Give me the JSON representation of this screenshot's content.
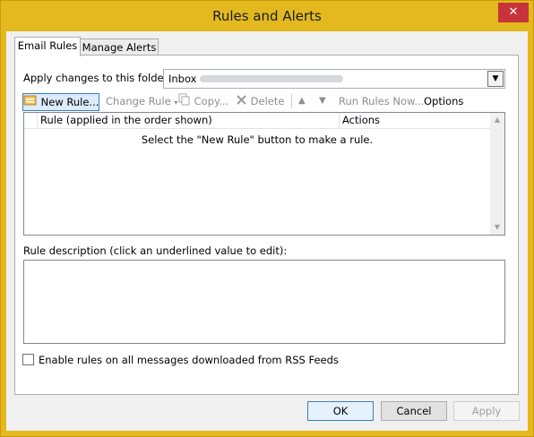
{
  "window": {
    "title": "Rules and Alerts",
    "close_glyph": "✕"
  },
  "tabs": [
    {
      "label": "Email Rules",
      "active": true
    },
    {
      "label": "Manage Alerts",
      "active": false
    }
  ],
  "folder": {
    "label": "Apply changes to this folder:",
    "value": "Inbox"
  },
  "toolbar": {
    "new_rule": "New Rule...",
    "change_rule": "Change Rule",
    "copy": "Copy...",
    "delete": "Delete",
    "run_rules": "Run Rules Now...",
    "options": "Options"
  },
  "rules_list": {
    "columns": [
      "Rule (applied in the order shown)",
      "Actions"
    ],
    "empty_message": "Select the \"New Rule\" button to make a rule."
  },
  "description": {
    "label": "Rule description (click an underlined value to edit):"
  },
  "rss": {
    "label": "Enable rules on all messages downloaded from RSS Feeds",
    "checked": false
  },
  "buttons": {
    "ok": "OK",
    "cancel": "Cancel",
    "apply": "Apply"
  },
  "colors": {
    "frame": "#e3b91f",
    "close": "#c7333a"
  }
}
